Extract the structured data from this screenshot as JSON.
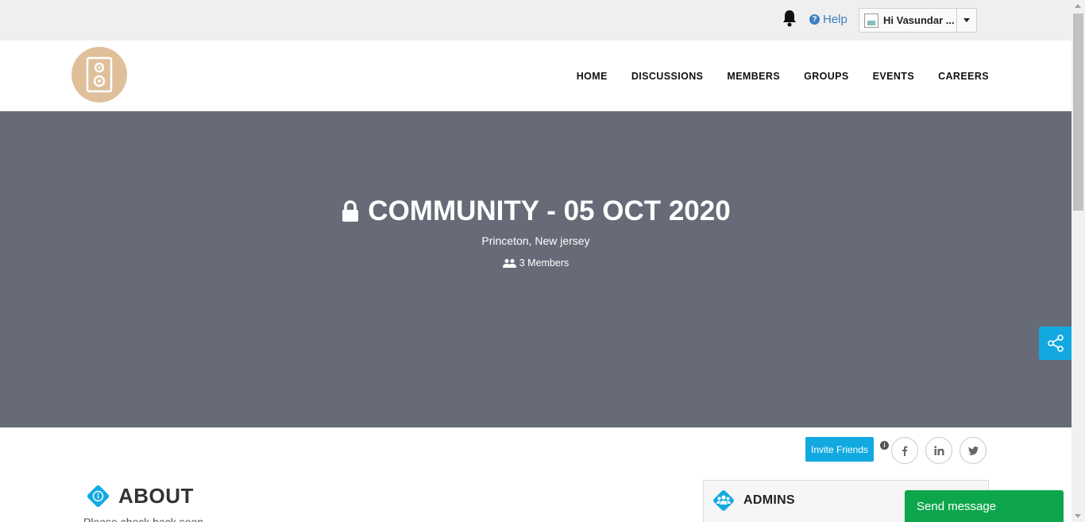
{
  "topbar": {
    "help_label": "Help",
    "user_label": "Hi Vasundar ..."
  },
  "nav": {
    "items": [
      "HOME",
      "DISCUSSIONS",
      "MEMBERS",
      "GROUPS",
      "EVENTS",
      "CAREERS"
    ]
  },
  "hero": {
    "title": "COMMUNITY - 05 OCT 2020",
    "location": "Princeton, New jersey",
    "members": "3 Members"
  },
  "actions": {
    "invite_label": "Invite Friends",
    "info_icon": "i"
  },
  "about": {
    "title": "ABOUT",
    "text": "Please check back soon"
  },
  "admins": {
    "title": "ADMINS"
  },
  "chat": {
    "send_label": "Send message"
  },
  "colors": {
    "accent": "#12a9e1",
    "hero_bg": "#676b77",
    "logo_bg": "#dfc09a",
    "send_green": "#0ea64c",
    "help_link": "#3a7fc1"
  },
  "icons": [
    "bell-icon",
    "help-icon",
    "avatar",
    "chevron-down-icon",
    "speaker-logo",
    "lock-icon",
    "users-icon",
    "share-icon",
    "info-icon",
    "facebook-icon",
    "linkedin-icon",
    "twitter-icon"
  ]
}
